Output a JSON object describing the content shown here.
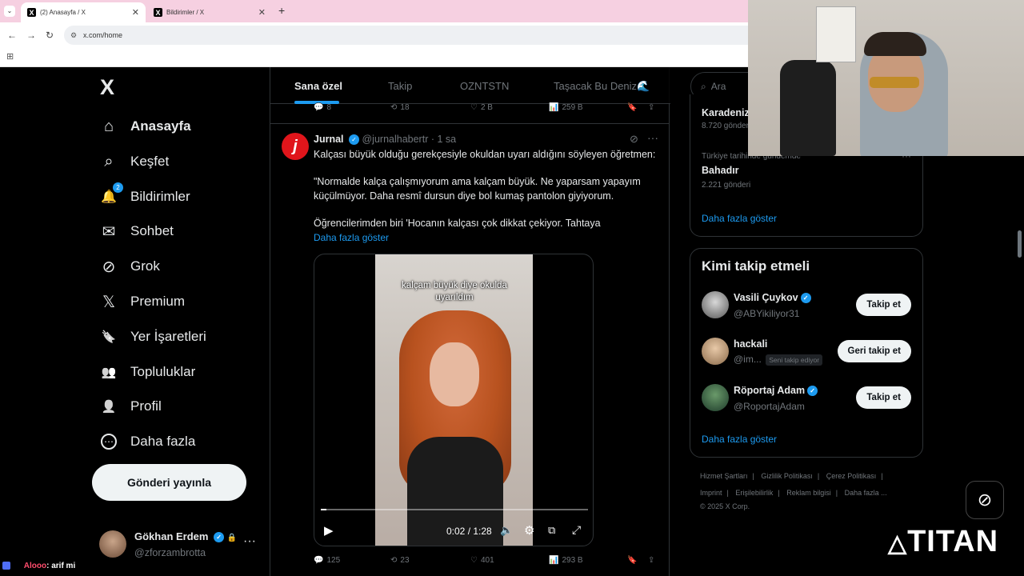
{
  "browser": {
    "tabs": [
      {
        "label": "(2) Anasayfa / X"
      },
      {
        "label": "Bildirimler / X"
      }
    ],
    "new_tab": "+",
    "url": "x.com/home"
  },
  "sidebar": {
    "logo": "X",
    "items": [
      {
        "label": "Anasayfa",
        "icon": "home-icon",
        "glyph": "⌂"
      },
      {
        "label": "Keşfet",
        "icon": "search-icon",
        "glyph": "⌕"
      },
      {
        "label": "Bildirimler",
        "icon": "bell-icon",
        "glyph": "🔔",
        "badge": "2"
      },
      {
        "label": "Sohbet",
        "icon": "mail-icon",
        "glyph": "✉"
      },
      {
        "label": "Grok",
        "icon": "grok-icon",
        "glyph": "⊘"
      },
      {
        "label": "Premium",
        "icon": "x-icon",
        "glyph": "𝕏"
      },
      {
        "label": "Yer İşaretleri",
        "icon": "bookmark-icon",
        "glyph": "🔖"
      },
      {
        "label": "Topluluklar",
        "icon": "communities-icon",
        "glyph": "👥"
      },
      {
        "label": "Profil",
        "icon": "profile-icon",
        "glyph": "👤"
      },
      {
        "label": "Daha fazla",
        "icon": "more-circle-icon",
        "glyph": "⋯"
      }
    ],
    "post_button": "Gönderi yayınla",
    "account": {
      "name": "Gökhan Erdem",
      "handle": "@zforzambrotta"
    }
  },
  "feed": {
    "tabs": [
      "Sana özel",
      "Takip",
      "OZNTSTN",
      "Taşacak Bu Deniz🌊"
    ],
    "prev_actions": {
      "replies": "8",
      "reposts": "18",
      "likes": "2 B",
      "views": "259 B"
    },
    "tweet": {
      "avatar_letter": "j",
      "author": "Jurnal",
      "handle": "@jurnalhabertr",
      "time": "· 1 sa",
      "line1": "Kalçası büyük olduğu gerekçesiyle okuldan uyarı aldığını söyleyen öğretmen:",
      "line2": "\"Normalde kalça çalışmıyorum ama kalçam büyük. Ne yaparsam yapayım küçülmüyor. Daha resmî dursun diye bol kumaş pantolon giyiyorum.",
      "line3": "Öğrencilerimden biri 'Hocanın kalçası çok dikkat çekiyor. Tahtaya",
      "show_more": "Daha fazla göster",
      "video_caption": "kalçam büyük diye okulda uyarıldım",
      "video_time": "0:02 / 1:28",
      "video_progress": 0.02,
      "actions": {
        "replies": "125",
        "reposts": "23",
        "likes": "401",
        "views": "293 B"
      }
    }
  },
  "right": {
    "search_placeholder": "Ara",
    "trends": [
      {
        "context": "",
        "name": "Karadeniz",
        "count": "8.720 gönderi"
      },
      {
        "context": "Türkiye tarihinde gündemde",
        "name": "Bahadır",
        "count": "2.221 gönderi"
      }
    ],
    "show_more": "Daha fazla göster",
    "who_to_follow": {
      "title": "Kimi takip etmeli",
      "users": [
        {
          "name": "Vasili Çuykov",
          "handle": "@ABYikiliyor31",
          "button": "Takip et"
        },
        {
          "name": "hackali",
          "handle": "@im...",
          "follows_you": "Seni takip ediyor",
          "button": "Geri takip et"
        },
        {
          "name": "Röportaj Adam",
          "handle": "@RoportajAdam",
          "button": "Takip et"
        }
      ],
      "show_more": "Daha fazla göster"
    },
    "footer": {
      "row1": [
        "Hizmet Şartları",
        "Gizlilik Politikası",
        "Çerez Politikası"
      ],
      "row2": [
        "Imprint",
        "Erişilebilirlik",
        "Reklam bilgisi",
        "Daha fazla ..."
      ],
      "copyright": "© 2025 X Corp."
    }
  },
  "overlay": {
    "brand_logo": "TITAN",
    "chat": {
      "user": "Alooo",
      "message": ": arif mi"
    }
  }
}
